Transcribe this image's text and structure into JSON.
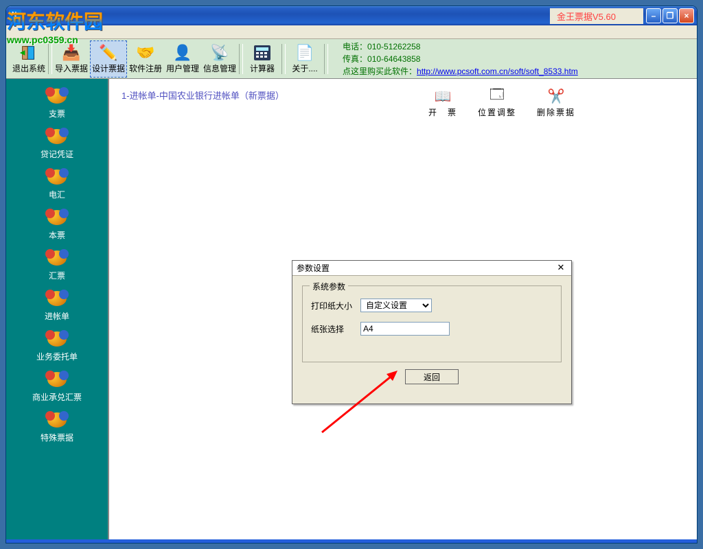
{
  "watermark": {
    "text": "河东软件园",
    "url": "www.pc0359.cn"
  },
  "titlebar": {
    "title": "",
    "brand": "金王票据V5.60"
  },
  "winbtns": {
    "min": "–",
    "max": "❐",
    "close": "×"
  },
  "toolbar": {
    "items": [
      {
        "label": "退出系统",
        "icon": "🚪"
      },
      {
        "label": "导入票据",
        "icon": "📥"
      },
      {
        "label": "设计票据",
        "icon": "✏️"
      },
      {
        "label": "软件注册",
        "icon": "🤝"
      },
      {
        "label": "用户管理",
        "icon": "👤"
      },
      {
        "label": "信息管理",
        "icon": "📡"
      },
      {
        "label": "计算器",
        "icon": "🖩"
      },
      {
        "label": "关于....",
        "icon": "📄"
      }
    ],
    "info": {
      "phone_label": "电话：",
      "phone": "010-51262258",
      "fax_label": "传真：",
      "fax": "010-64643858",
      "buy_label": "点这里购买此软件：",
      "buy_url": "http://www.pcsoft.com.cn/soft/soft_8533.htm"
    }
  },
  "sidebar": {
    "items": [
      {
        "label": "支票"
      },
      {
        "label": "贷记凭证"
      },
      {
        "label": "电汇"
      },
      {
        "label": "本票"
      },
      {
        "label": "汇票"
      },
      {
        "label": "进帐单"
      },
      {
        "label": "业务委托单"
      },
      {
        "label": "商业承兑汇票"
      },
      {
        "label": "特殊票据"
      }
    ]
  },
  "content": {
    "heading": "1-进帐单-中国农业银行进帐单（新票据）",
    "actions": [
      {
        "label": "开　票",
        "icon": "📖"
      },
      {
        "label": "位置调整",
        "icon": "🗔"
      },
      {
        "label": "删除票据",
        "icon": "✂️"
      }
    ]
  },
  "dialog": {
    "title": "参数设置",
    "legend": "系统参数",
    "paper_size_label": "打印纸大小",
    "paper_size_value": "自定义设置",
    "paper_select_label": "纸张选择",
    "paper_select_value": "A4",
    "return_btn": "返回",
    "close": "✕"
  }
}
